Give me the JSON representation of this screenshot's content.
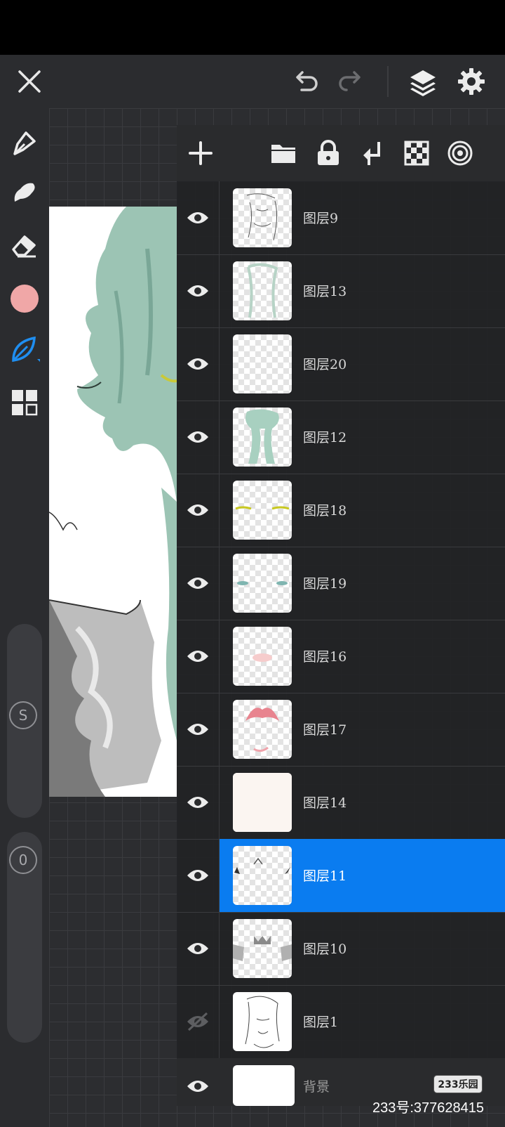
{
  "layers": [
    {
      "name": "图层9",
      "visible": true,
      "selected": false
    },
    {
      "name": "图层13",
      "visible": true,
      "selected": false
    },
    {
      "name": "图层20",
      "visible": true,
      "selected": false
    },
    {
      "name": "图层12",
      "visible": true,
      "selected": false
    },
    {
      "name": "图层18",
      "visible": true,
      "selected": false
    },
    {
      "name": "图层19",
      "visible": true,
      "selected": false
    },
    {
      "name": "图层16",
      "visible": true,
      "selected": false
    },
    {
      "name": "图层17",
      "visible": true,
      "selected": false
    },
    {
      "name": "图层14",
      "visible": true,
      "selected": false
    },
    {
      "name": "图层11",
      "visible": true,
      "selected": true
    },
    {
      "name": "图层10",
      "visible": true,
      "selected": false
    },
    {
      "name": "图层1",
      "visible": false,
      "selected": false
    },
    {
      "name": "背景",
      "visible": true,
      "selected": false
    }
  ],
  "sliders": {
    "size_label": "S",
    "opacity_label": "0"
  },
  "colors": {
    "accent": "#0a7cf0",
    "brush_color": "#f0a7a7",
    "tool_blue": "#1f8ef0"
  },
  "watermark": {
    "badge": "233乐园",
    "text": "233号:377628415"
  }
}
